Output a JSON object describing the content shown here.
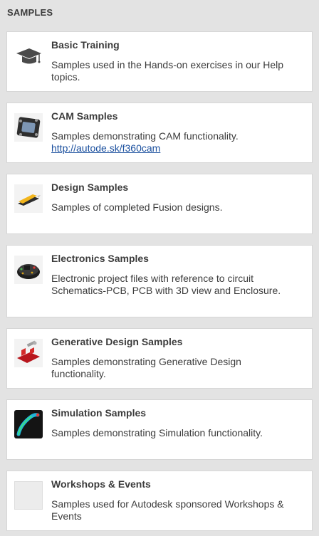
{
  "header": {
    "title": "SAMPLES"
  },
  "samples": [
    {
      "title": "Basic Training",
      "description": "Samples used in the Hands-on exercises in our Help topics.",
      "icon": "graduation-cap-icon"
    },
    {
      "title": "CAM Samples",
      "description": "Samples demonstrating CAM functionality.",
      "link": "http://autode.sk/f360cam",
      "icon": "cam-part-thumbnail"
    },
    {
      "title": "Design Samples",
      "description": "Samples of completed Fusion designs.",
      "icon": "utility-knife-thumbnail"
    },
    {
      "title": "Electronics Samples",
      "description": "Electronic project files with reference to circuit Schematics-PCB, PCB with 3D view and Enclosure.",
      "icon": "electronics-board-thumbnail"
    },
    {
      "title": "Generative Design Samples",
      "description": "Samples demonstrating Generative Design functionality.",
      "icon": "generative-part-thumbnail"
    },
    {
      "title": "Simulation Samples",
      "description": "Samples demonstrating Simulation functionality.",
      "icon": "simulation-thumbnail"
    },
    {
      "title": "Workshops & Events",
      "description": "Samples used for Autodesk sponsored Workshops & Events",
      "icon": "blank-thumbnail"
    }
  ],
  "colors": {
    "background": "#e3e3e3",
    "card": "#ffffff",
    "text": "#3c3c3c",
    "link": "#1a4f9e"
  }
}
